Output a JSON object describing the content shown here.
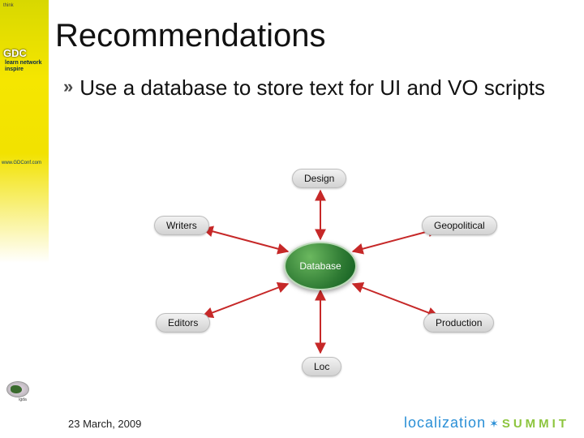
{
  "sidebar": {
    "tiny": "think",
    "gdc": "GDC",
    "gdc_sub": "learn\nnetwork\ninspire",
    "url": "www.GDConf.com"
  },
  "title": "Recommendations",
  "bullet": "Use a database to store text for UI and VO scripts",
  "diagram": {
    "center": "Database",
    "top": "Design",
    "left1": "Writers",
    "right1": "Geopolitical",
    "left2": "Editors",
    "right2": "Production",
    "bottom": "Loc"
  },
  "footer": {
    "date": "23 March, 2009",
    "logo_a": "localization",
    "logo_b": "SUMMIT"
  }
}
